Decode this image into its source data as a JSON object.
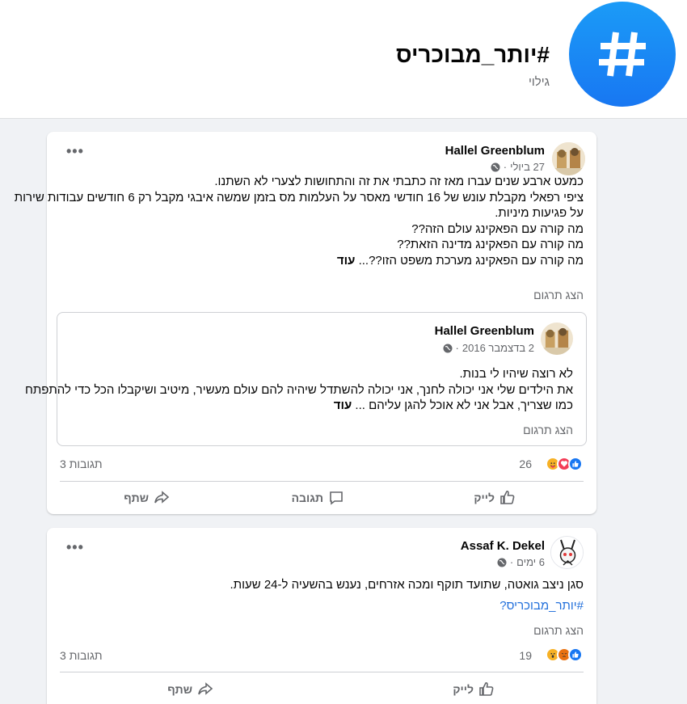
{
  "header": {
    "hashtag_title": "#יותר_מבוכריס",
    "subtitle": "גילוי",
    "icon": "hashtag-icon",
    "accent": "#1877f2"
  },
  "posts": [
    {
      "author": "Hallel Greenblum",
      "date": "27 ביולי",
      "privacy_icon": "globe-icon",
      "lines": [
        "כמעט ארבע שנים עברו מאז זה כתבתי את זה והתחושות לצערי לא השתנו.",
        "ציפי רפאלי מקבלת עונש של 16 חודשי מאסר על העלמות מס בזמן שמשה איבגי מקבל רק 6 חודשים עבודות שירות",
        "על פגיעות מיניות.",
        "מה קורה עם הפאקינג עולם הזה??",
        "מה קורה עם הפאקינג מדינה הזאת??",
        "מה קורה עם הפאקינג מערכת משפט הזו??..."
      ],
      "more_label": "עוד",
      "translate_label": "הצג תרגום",
      "shared": {
        "author": "Hallel Greenblum",
        "date": "2 בדצמבר 2016",
        "lines": [
          "לא רוצה שיהיו לי בנות.",
          "את הילדים שלי אני יכולה לחנך, אני יכולה להשתדל שיהיה להם עולם מעשיר, מיטיב ושיקבלו הכל כדי להתפתח",
          "כמו שצריך, אבל אני לא אוכל להגן עליהם ..."
        ],
        "more_label": "עוד",
        "translate_label": "הצג תרגום"
      },
      "reaction_count": "26",
      "reactions": [
        "like",
        "love",
        "care"
      ],
      "comments_count": "3 תגובות",
      "actions": {
        "like": "לייק",
        "comment": "תגובה",
        "share": "שתף"
      }
    },
    {
      "author": "Assaf K. Dekel",
      "date": "6 ימים",
      "privacy_icon": "globe-icon",
      "lines": [
        "סגן ניצב גואטה, שתועד תוקף ומכה אזרחים, נענש בהשעיה ל-24 שעות."
      ],
      "hashtag_link": "#יותר_מבוכריס?",
      "translate_label": "הצג תרגום",
      "reaction_count": "19",
      "reactions": [
        "like",
        "angry",
        "wow"
      ],
      "comments_count": "3 תגובות",
      "actions": {
        "like": "לייק",
        "share": "שתף"
      }
    }
  ]
}
